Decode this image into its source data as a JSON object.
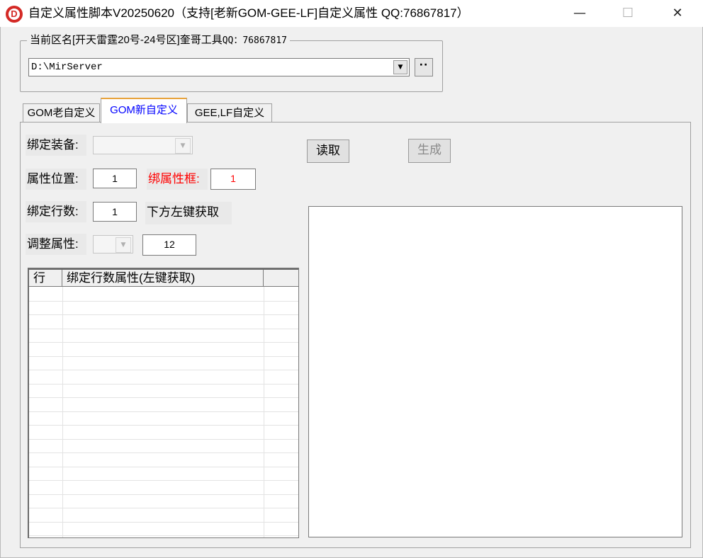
{
  "window": {
    "title": "自定义属性脚本V20250620（支持[老新GOM-GEE-LF]自定义属性 QQ:76867817）",
    "icon_letter": "D",
    "minimize": "—",
    "maximize": "☐",
    "close": "✕"
  },
  "server_group": {
    "title_main": "当前区名[开天雷霆20号-24号区]奎哥工具",
    "title_qq": "QQ：76867817",
    "path_value": "D:\\MirServer",
    "browse_label": "··"
  },
  "tabs": [
    {
      "label": "GOM老自定义",
      "active": false
    },
    {
      "label": "GOM新自定义",
      "active": true
    },
    {
      "label": "GEE,LF自定义",
      "active": false
    }
  ],
  "form": {
    "bind_equip_label": "绑定装备:",
    "bind_equip_value": "",
    "attr_pos_label": "属性位置:",
    "attr_pos_value": "1",
    "bind_attr_box_label": "绑属性框:",
    "bind_attr_box_value": "1",
    "bind_rows_label": "绑定行数:",
    "bind_rows_value": "1",
    "bind_rows_hint": "下方左键获取",
    "adjust_attr_label": "调整属性:",
    "adjust_attr_value": "",
    "adjust_attr_number": "12"
  },
  "buttons": {
    "read": "读取",
    "generate": "生成"
  },
  "grid": {
    "columns": [
      "行",
      "绑定行数属性(左键获取)",
      ""
    ],
    "rows": []
  },
  "output": {
    "text": ""
  },
  "colors": {
    "accent_tab_border": "#e8a33c",
    "active_tab_text": "#0000ff",
    "highlight_label": "#ff0000",
    "icon_red": "#d42a26"
  }
}
